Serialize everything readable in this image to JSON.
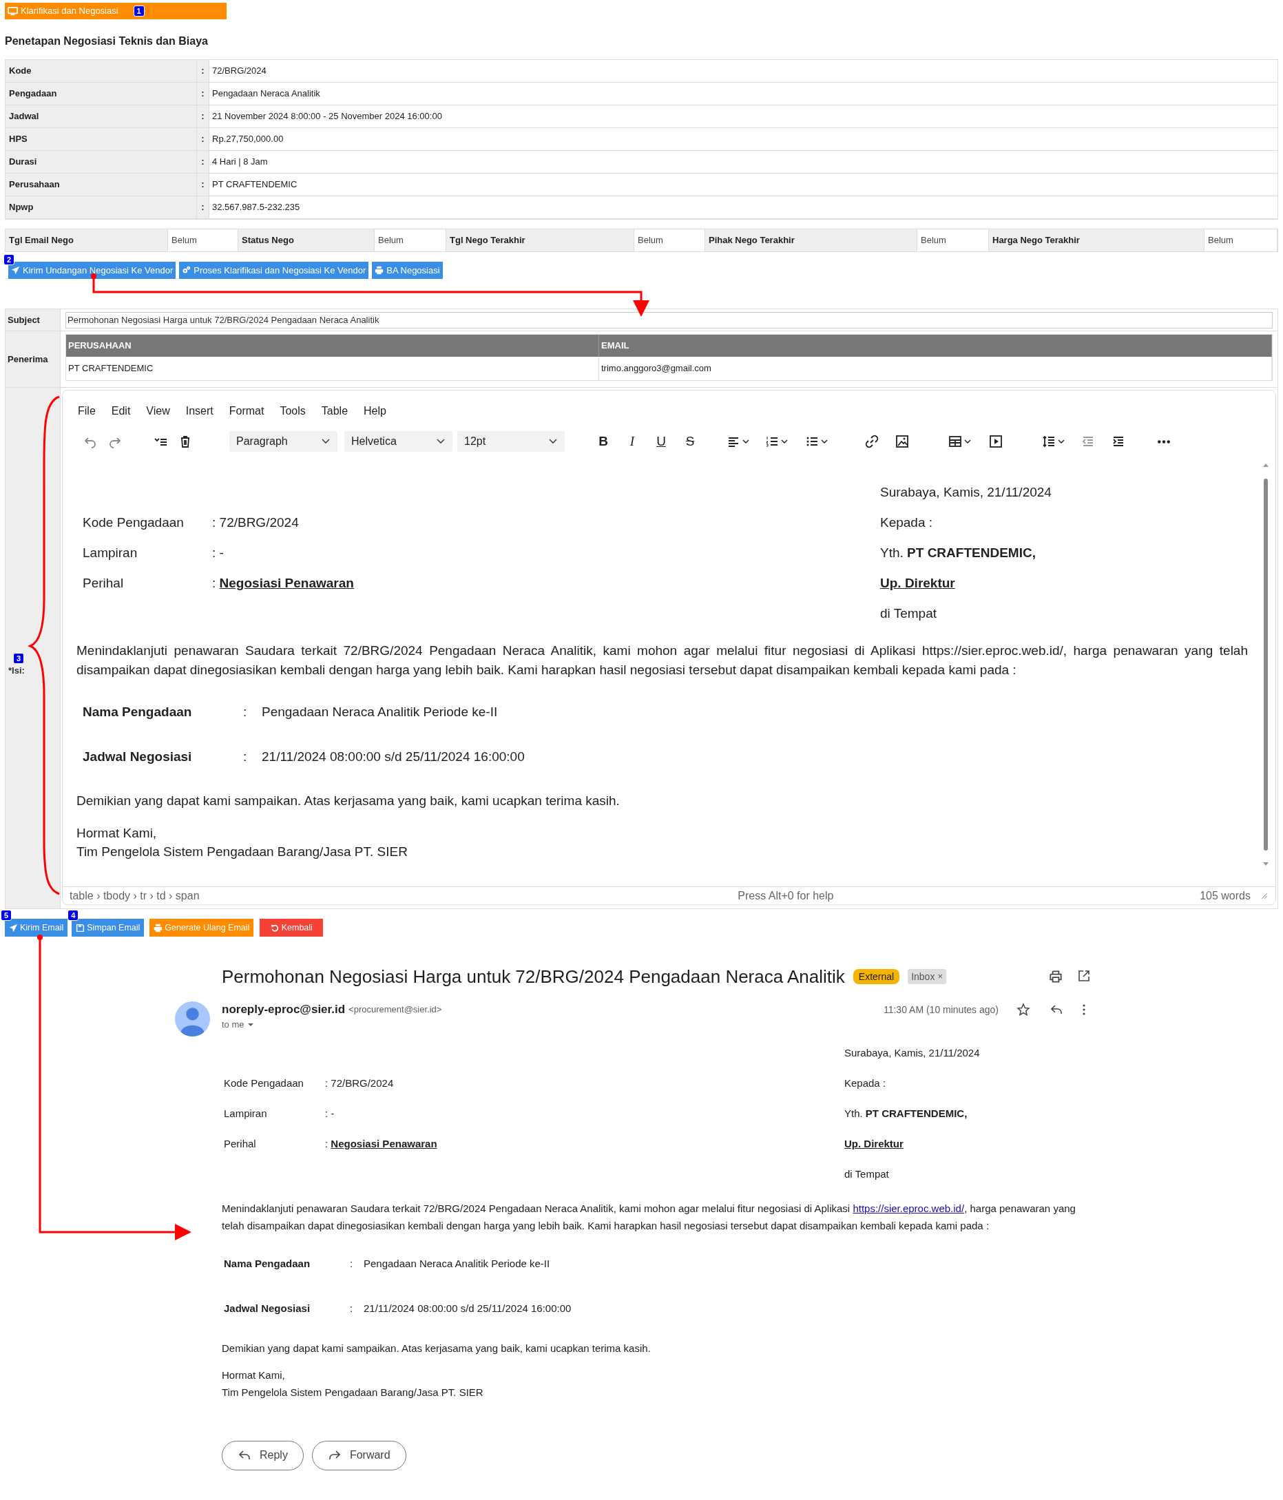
{
  "header": {
    "title": "Klarifikasi dan Negosiasi",
    "badge": "1"
  },
  "heading": "Penetapan Negosiasi Teknis dan Biaya",
  "info": [
    {
      "label": "Kode",
      "colon": ":",
      "value": "72/BRG/2024"
    },
    {
      "label": "Pengadaan",
      "colon": ":",
      "value": "Pengadaan Neraca Analitik"
    },
    {
      "label": "Jadwal",
      "colon": ":",
      "value": "21 November 2024 8:00:00 - 25 November 2024 16:00:00"
    },
    {
      "label": "HPS",
      "colon": ":",
      "value": "Rp.27,750,000.00"
    },
    {
      "label": "Durasi",
      "colon": ":",
      "value": "4 Hari | 8 Jam"
    },
    {
      "label": "Perusahaan",
      "colon": ":",
      "value": "PT CRAFTENDEMIC"
    },
    {
      "label": "Npwp",
      "colon": ":",
      "value": "32.567.987.5-232.235"
    }
  ],
  "status": [
    {
      "label": "Tgl Email Nego",
      "value": "Belum"
    },
    {
      "label": "Status Nego",
      "value": "Belum"
    },
    {
      "label": "Tgl Nego Terakhir",
      "value": "Belum"
    },
    {
      "label": "Pihak Nego Terakhir",
      "value": "Belum"
    },
    {
      "label": "Harga Nego Terakhir",
      "value": "Belum"
    }
  ],
  "actions_badge": "2",
  "actions": [
    {
      "label": "Kirim Undangan Negosiasi Ke Vendor"
    },
    {
      "label": "Proses Klarifikasi dan Negosiasi Ke Vendor"
    },
    {
      "label": "BA Negosiasi"
    }
  ],
  "subject": {
    "label": "Subject",
    "value": "Permohonan Negosiasi Harga untuk 72/BRG/2024  Pengadaan Neraca Analitik"
  },
  "recipients": {
    "label": "Penerima",
    "columns": [
      "PERUSAHAAN",
      "EMAIL"
    ],
    "rows": [
      [
        "PT CRAFTENDEMIC",
        "trimo.anggoro3@gmail.com"
      ]
    ]
  },
  "body": {
    "label": "*Isi:",
    "badge": "3"
  },
  "editor": {
    "menu": [
      "File",
      "Edit",
      "View",
      "Insert",
      "Format",
      "Tools",
      "Table",
      "Help"
    ],
    "selects": [
      "Paragraph",
      "Helvetica",
      "12pt"
    ],
    "text_buttons": [
      "B",
      "I",
      "U",
      "S"
    ],
    "path": "table › tbody › tr › td › span",
    "help": "Press Alt+0 for help",
    "word_count": "105 words",
    "letter": {
      "right": [
        {
          "text": "Surabaya, Kamis, 21/11/2024",
          "kind": "plain"
        },
        {
          "text": "Kepada :",
          "kind": "plain"
        },
        {
          "text": "Yth. **PT CRAFTENDEMIC,**",
          "kind": "plain"
        },
        {
          "text": "Up. Direktur",
          "kind": "heading"
        },
        {
          "text": "di Tempat",
          "kind": "plain"
        }
      ],
      "meta": [
        {
          "label": "Kode Pengadaan",
          "colon": ":",
          "value": "72/BRG/2024",
          "strong": false
        },
        {
          "label": "Lampiran",
          "colon": ":",
          "value": "-",
          "strong": false
        },
        {
          "label": "Perihal",
          "colon": ":",
          "value": "Negosiasi Penawaran",
          "strong": true
        }
      ],
      "paragraph": [
        {
          "text": "Menindaklanjuti penawaran Saudara terkait 72/BRG/2024 Pengadaan Neraca Analitik, kami mohon agar melalui fitur negosiasi di Aplikasi https://sier.eproc.web.id/, harga penawaran yang telah disampaikan dapat dinegosiasikan kembali dengan harga yang lebih baik. Kami harapkan hasil negosiasi tersebut dapat disampaikan kembali kepada kami pada :"
        }
      ],
      "details": [
        {
          "label": "Nama Pengadaan",
          "colon": ":",
          "value": "Pengadaan Neraca Analitik Periode ke-II"
        },
        {
          "label": "Jadwal Negosiasi",
          "colon": ":",
          "value": "21/11/2024 08:00:00 s/d 25/11/2024 16:00:00"
        }
      ],
      "closing": "Demikian yang dapat kami sampaikan. Atas kerjasama yang baik, kami ucapkan terima kasih.",
      "signoff": [
        "Hormat Kami,",
        "Tim Pengelola Sistem Pengadaan Barang/Jasa PT. SIER"
      ]
    }
  },
  "buttons": [
    {
      "label": "Kirim Email",
      "kind": "primary",
      "badge": "5"
    },
    {
      "label": "Simpan Email",
      "kind": "primary",
      "badge": "4"
    },
    {
      "label": "Generate Ulang Email",
      "kind": "warning"
    },
    {
      "label": "Kembali",
      "kind": "danger"
    }
  ],
  "email": {
    "subject": "Permohonan Negosiasi Harga untuk 72/BRG/2024 Pengadaan Neraca Analitik",
    "tags": [
      {
        "label": "External",
        "kind": "external"
      },
      {
        "label": "Inbox",
        "kind": "inbox",
        "remove": "×"
      }
    ],
    "sender": "noreply-eproc@sier.id",
    "address": "<procurement@sier.id>",
    "to": "to me",
    "time": "11:30 AM (10 minutes ago)",
    "letter": {
      "right": [
        {
          "text": "Surabaya, Kamis, 21/11/2024",
          "kind": "plain"
        },
        {
          "text": "Kepada :",
          "kind": "plain"
        },
        {
          "text": "Yth. **PT CRAFTENDEMIC,**",
          "kind": "plain"
        },
        {
          "text": "Up. Direktur",
          "kind": "heading"
        },
        {
          "text": "di Tempat",
          "kind": "plain"
        }
      ],
      "meta": [
        {
          "label": "Kode Pengadaan",
          "colon": ":",
          "value": "72/BRG/2024",
          "strong": false
        },
        {
          "label": "Lampiran",
          "colon": ":",
          "value": "-",
          "strong": false
        },
        {
          "label": "Perihal",
          "colon": ":",
          "value": "Negosiasi Penawaran",
          "strong": true
        }
      ],
      "paragraph": [
        {
          "text": "Menindaklanjuti penawaran Saudara terkait 72/BRG/2024 Pengadaan Neraca Analitik, kami mohon agar melalui fitur negosiasi di Aplikasi ",
          "kind": "text"
        },
        {
          "text": "https://sier.eproc.web.id/",
          "kind": "link"
        },
        {
          "text": ", harga penawaran yang telah disampaikan dapat dinegosiasikan kembali dengan harga yang lebih baik. Kami harapkan hasil negosiasi tersebut dapat disampaikan kembali kepada kami pada :",
          "kind": "text"
        }
      ],
      "details": [
        {
          "label": "Nama Pengadaan",
          "colon": ":",
          "value": "Pengadaan Neraca Analitik Periode ke-II"
        },
        {
          "label": "Jadwal Negosiasi",
          "colon": ":",
          "value": "21/11/2024 08:00:00 s/d 25/11/2024 16:00:00"
        }
      ],
      "closing": "Demikian yang dapat kami sampaikan. Atas kerjasama yang baik, kami ucapkan terima kasih.",
      "signoff": [
        "Hormat Kami,",
        "Tim Pengelola Sistem Pengadaan Barang/Jasa PT. SIER"
      ]
    },
    "actions": [
      {
        "label": "Reply",
        "kind": "reply"
      },
      {
        "label": "Forward",
        "kind": "forward"
      }
    ]
  }
}
